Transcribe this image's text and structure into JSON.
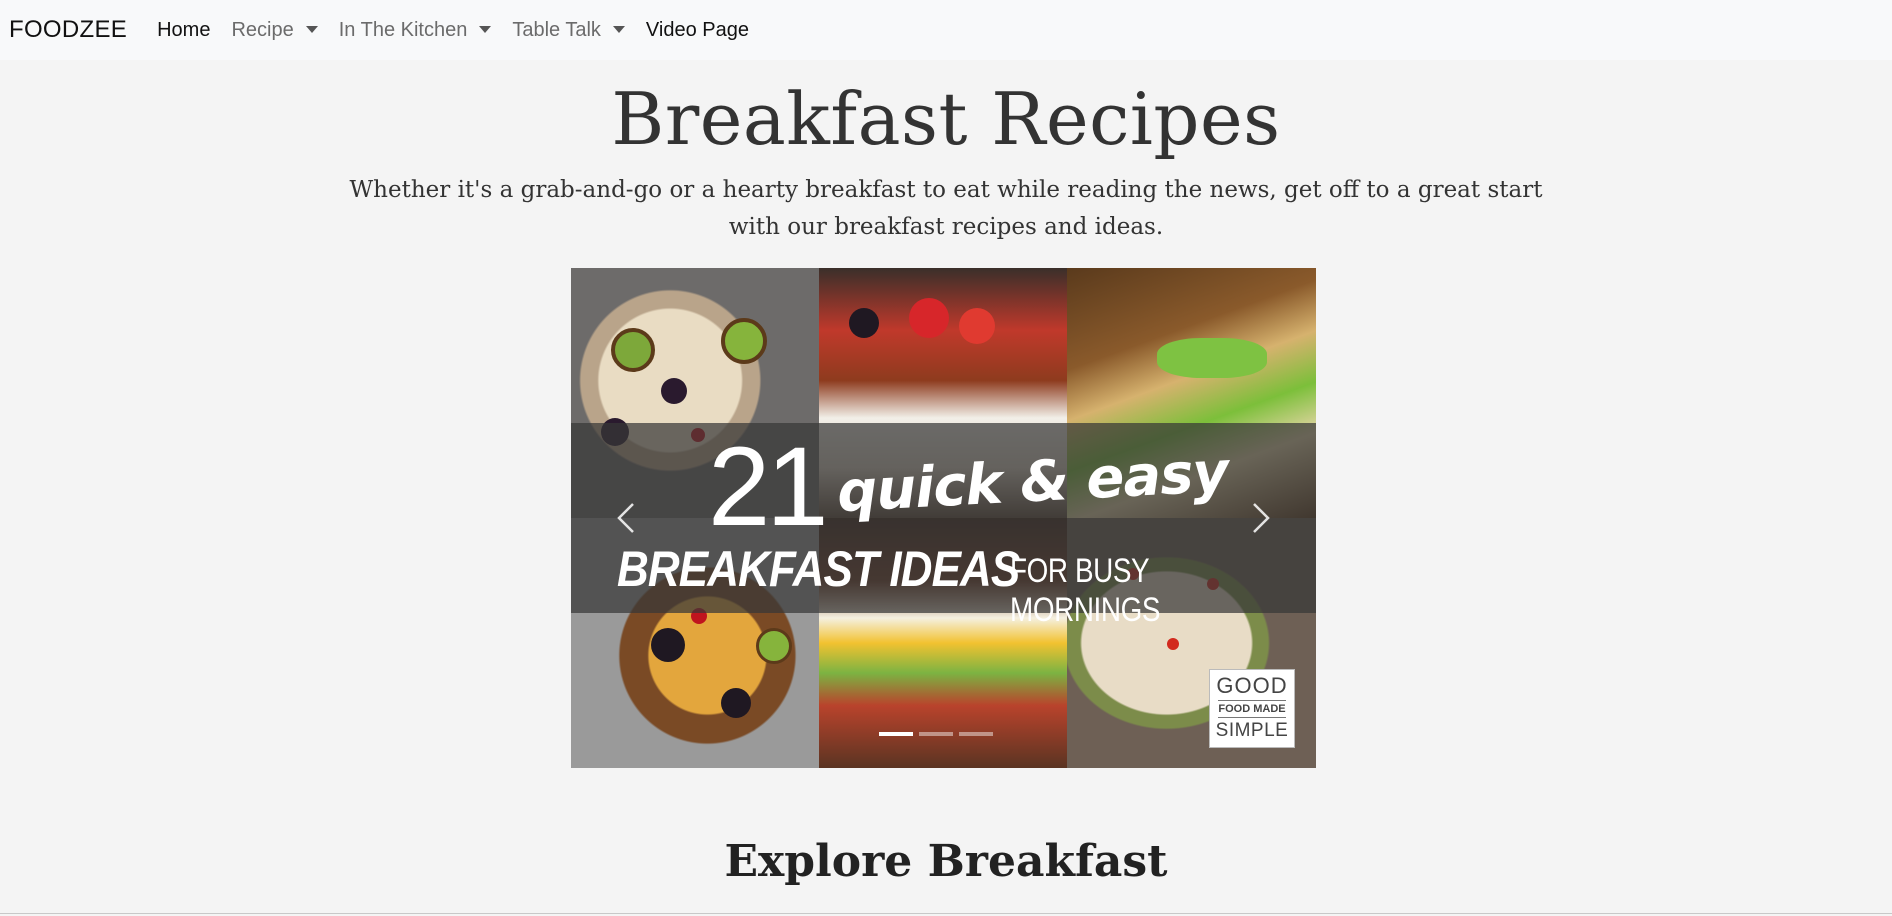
{
  "navbar": {
    "brand": "FOODZEE",
    "items": [
      {
        "label": "Home",
        "dropdown": false
      },
      {
        "label": "Recipe",
        "dropdown": true
      },
      {
        "label": "In The Kitchen",
        "dropdown": true
      },
      {
        "label": "Table Talk",
        "dropdown": true
      },
      {
        "label": "Video Page",
        "dropdown": false
      }
    ]
  },
  "hero": {
    "title": "Breakfast Recipes",
    "intro": "Whether it's a grab-and-go or a hearty breakfast to eat while reading the news, get off to a great start with our breakfast recipes and ideas."
  },
  "carousel": {
    "slide": {
      "number": "21",
      "script_text": "quick & easy",
      "caps_text": "BREAKFAST IDEAS",
      "small_text": "FOR BUSY MORNINGS",
      "logo": {
        "line1": "GOOD",
        "line2": "FOOD MADE",
        "line3": "SIMPLE"
      }
    },
    "indicator_count": 3,
    "active_index": 0,
    "controls": {
      "prev_icon": "chevron-left-icon",
      "next_icon": "chevron-right-icon"
    }
  },
  "explore": {
    "title": "Explore Breakfast"
  },
  "colors": {
    "background": "#f4f4f4",
    "navbar_bg": "#f8f9fa",
    "text": "#333333"
  }
}
